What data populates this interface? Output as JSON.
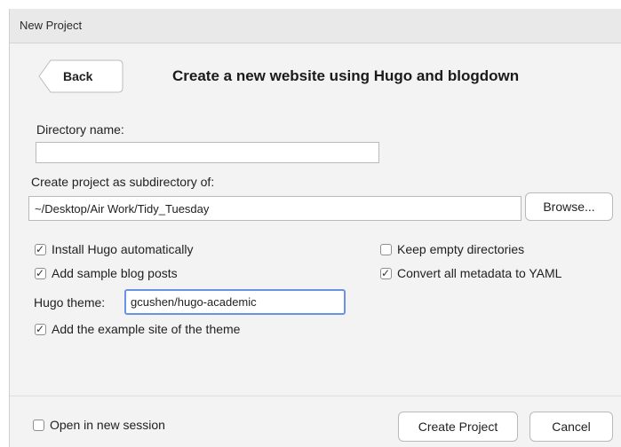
{
  "window": {
    "title": "New Project"
  },
  "header": {
    "back_label": "Back",
    "heading": "Create a new website using Hugo and blogdown"
  },
  "form": {
    "directory_name_label": "Directory name:",
    "directory_name_value": "",
    "subdirectory_label": "Create project as subdirectory of:",
    "subdirectory_value": "~/Desktop/Air Work/Tidy_Tuesday",
    "browse_label": "Browse...",
    "options": {
      "install_hugo": {
        "label": "Install Hugo automatically",
        "checked": true
      },
      "sample_posts": {
        "label": "Add sample blog posts",
        "checked": true
      },
      "keep_empty": {
        "label": "Keep empty directories",
        "checked": false
      },
      "convert_yaml": {
        "label": "Convert all metadata to YAML",
        "checked": true
      },
      "example_site": {
        "label": "Add the example site of the theme",
        "checked": true
      }
    },
    "hugo_theme_label": "Hugo theme:",
    "hugo_theme_value": "gcushen/hugo-academic"
  },
  "footer": {
    "open_new_session": {
      "label": "Open in new session",
      "checked": false
    },
    "create_label": "Create Project",
    "cancel_label": "Cancel"
  }
}
